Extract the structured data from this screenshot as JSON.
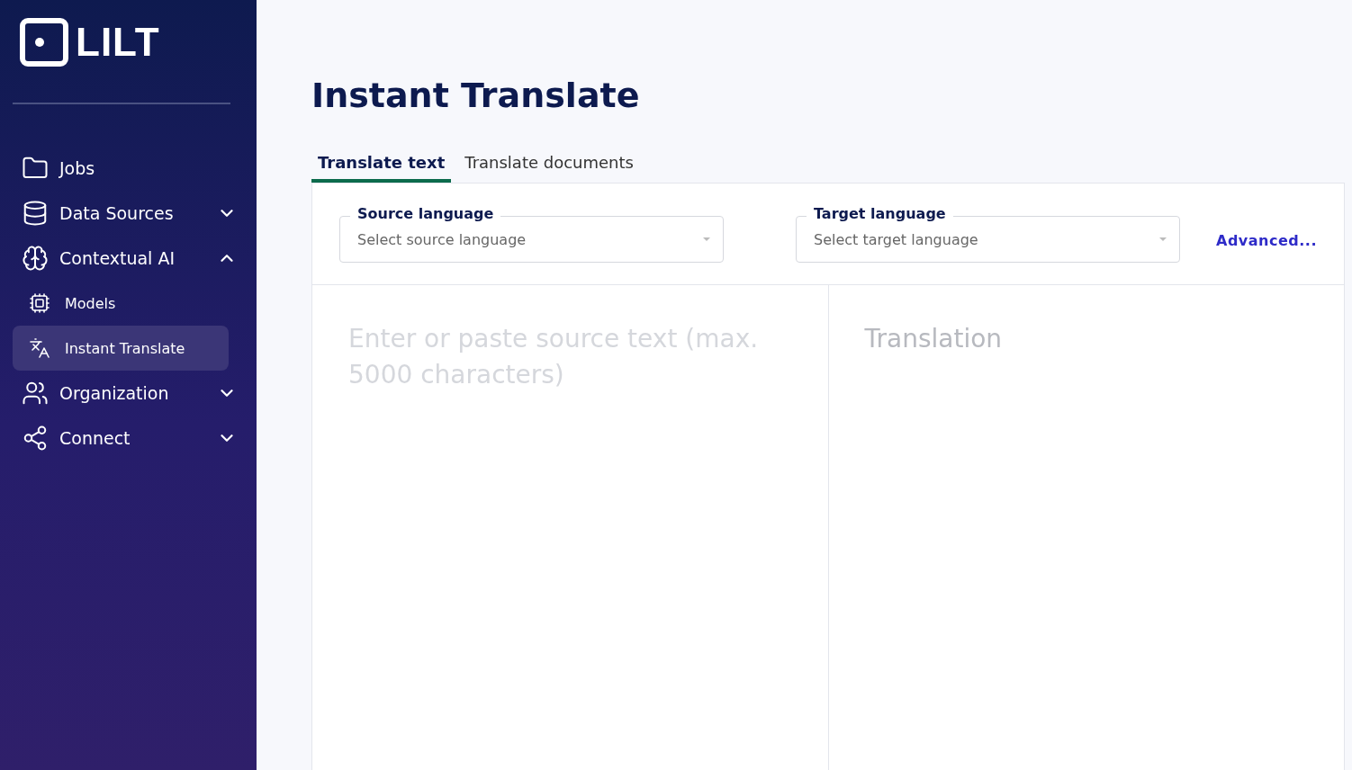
{
  "brand": {
    "name": "LILT"
  },
  "sidebar": {
    "items": [
      {
        "label": "Jobs",
        "kind": "link"
      },
      {
        "label": "Data Sources",
        "kind": "group",
        "expanded": false
      },
      {
        "label": "Contextual AI",
        "kind": "group",
        "expanded": true,
        "children": [
          {
            "label": "Models",
            "selected": false
          },
          {
            "label": "Instant Translate",
            "selected": true
          }
        ]
      },
      {
        "label": "Organization",
        "kind": "group",
        "expanded": false
      },
      {
        "label": "Connect",
        "kind": "group",
        "expanded": false
      }
    ]
  },
  "page": {
    "title": "Instant Translate"
  },
  "tabs": [
    {
      "label": "Translate text",
      "selected": true
    },
    {
      "label": "Translate documents",
      "selected": false
    }
  ],
  "source_language": {
    "label": "Source language",
    "placeholder": "Select source language"
  },
  "target_language": {
    "label": "Target language",
    "placeholder": "Select target language"
  },
  "advanced_link": "Advanced...",
  "source_text": {
    "placeholder": "Enter or paste source text (max. 5000 characters)"
  },
  "translation": {
    "placeholder": "Translation"
  }
}
